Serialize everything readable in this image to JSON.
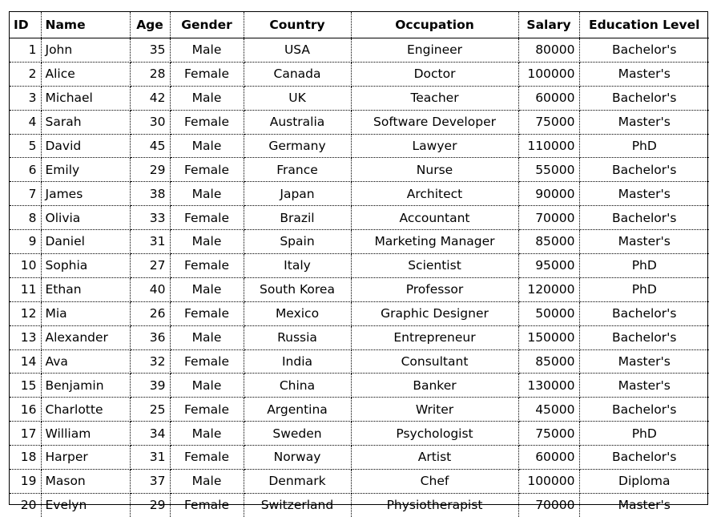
{
  "table": {
    "columns": [
      {
        "key": "id",
        "label": "ID"
      },
      {
        "key": "name",
        "label": "Name"
      },
      {
        "key": "age",
        "label": "Age"
      },
      {
        "key": "gender",
        "label": "Gender"
      },
      {
        "key": "country",
        "label": "Country"
      },
      {
        "key": "occupation",
        "label": "Occupation"
      },
      {
        "key": "salary",
        "label": "Salary"
      },
      {
        "key": "education",
        "label": "Education Level"
      }
    ],
    "rows": [
      {
        "id": "1",
        "name": "John",
        "age": "35",
        "gender": "Male",
        "country": "USA",
        "occupation": "Engineer",
        "salary": "80000",
        "education": "Bachelor's"
      },
      {
        "id": "2",
        "name": "Alice",
        "age": "28",
        "gender": "Female",
        "country": "Canada",
        "occupation": "Doctor",
        "salary": "100000",
        "education": "Master's"
      },
      {
        "id": "3",
        "name": "Michael",
        "age": "42",
        "gender": "Male",
        "country": "UK",
        "occupation": "Teacher",
        "salary": "60000",
        "education": "Bachelor's"
      },
      {
        "id": "4",
        "name": "Sarah",
        "age": "30",
        "gender": "Female",
        "country": "Australia",
        "occupation": "Software Developer",
        "salary": "75000",
        "education": "Master's"
      },
      {
        "id": "5",
        "name": "David",
        "age": "45",
        "gender": "Male",
        "country": "Germany",
        "occupation": "Lawyer",
        "salary": "110000",
        "education": "PhD"
      },
      {
        "id": "6",
        "name": "Emily",
        "age": "29",
        "gender": "Female",
        "country": "France",
        "occupation": "Nurse",
        "salary": "55000",
        "education": "Bachelor's"
      },
      {
        "id": "7",
        "name": "James",
        "age": "38",
        "gender": "Male",
        "country": "Japan",
        "occupation": "Architect",
        "salary": "90000",
        "education": "Master's"
      },
      {
        "id": "8",
        "name": "Olivia",
        "age": "33",
        "gender": "Female",
        "country": "Brazil",
        "occupation": "Accountant",
        "salary": "70000",
        "education": "Bachelor's"
      },
      {
        "id": "9",
        "name": "Daniel",
        "age": "31",
        "gender": "Male",
        "country": "Spain",
        "occupation": "Marketing Manager",
        "salary": "85000",
        "education": "Master's"
      },
      {
        "id": "10",
        "name": "Sophia",
        "age": "27",
        "gender": "Female",
        "country": "Italy",
        "occupation": "Scientist",
        "salary": "95000",
        "education": "PhD"
      },
      {
        "id": "11",
        "name": "Ethan",
        "age": "40",
        "gender": "Male",
        "country": "South Korea",
        "occupation": "Professor",
        "salary": "120000",
        "education": "PhD"
      },
      {
        "id": "12",
        "name": "Mia",
        "age": "26",
        "gender": "Female",
        "country": "Mexico",
        "occupation": "Graphic Designer",
        "salary": "50000",
        "education": "Bachelor's"
      },
      {
        "id": "13",
        "name": "Alexander",
        "age": "36",
        "gender": "Male",
        "country": "Russia",
        "occupation": "Entrepreneur",
        "salary": "150000",
        "education": "Bachelor's"
      },
      {
        "id": "14",
        "name": "Ava",
        "age": "32",
        "gender": "Female",
        "country": "India",
        "occupation": "Consultant",
        "salary": "85000",
        "education": "Master's"
      },
      {
        "id": "15",
        "name": "Benjamin",
        "age": "39",
        "gender": "Male",
        "country": "China",
        "occupation": "Banker",
        "salary": "130000",
        "education": "Master's"
      },
      {
        "id": "16",
        "name": "Charlotte",
        "age": "25",
        "gender": "Female",
        "country": "Argentina",
        "occupation": "Writer",
        "salary": "45000",
        "education": "Bachelor's"
      },
      {
        "id": "17",
        "name": "William",
        "age": "34",
        "gender": "Male",
        "country": "Sweden",
        "occupation": "Psychologist",
        "salary": "75000",
        "education": "PhD"
      },
      {
        "id": "18",
        "name": "Harper",
        "age": "31",
        "gender": "Female",
        "country": "Norway",
        "occupation": "Artist",
        "salary": "60000",
        "education": "Bachelor's"
      },
      {
        "id": "19",
        "name": "Mason",
        "age": "37",
        "gender": "Male",
        "country": "Denmark",
        "occupation": "Chef",
        "salary": "100000",
        "education": "Diploma"
      },
      {
        "id": "20",
        "name": "Evelyn",
        "age": "29",
        "gender": "Female",
        "country": "Switzerland",
        "occupation": "Physiotherapist",
        "salary": "70000",
        "education": "Master's"
      }
    ]
  },
  "style": {
    "text_color": "#000000",
    "border_color": "#000000",
    "background": "#ffffff"
  }
}
